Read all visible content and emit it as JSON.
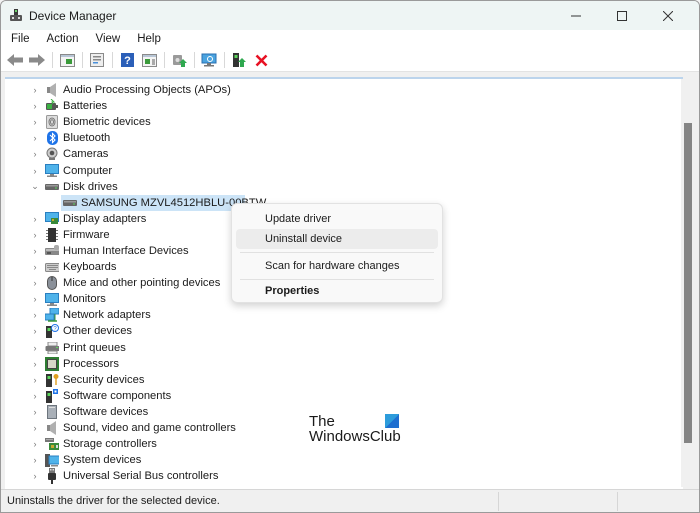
{
  "window": {
    "title": "Device Manager",
    "controls": {
      "minimize": "minimize",
      "maximize": "maximize",
      "close": "close"
    }
  },
  "menubar": {
    "items": [
      {
        "label": "File"
      },
      {
        "label": "Action"
      },
      {
        "label": "View"
      },
      {
        "label": "Help"
      }
    ]
  },
  "toolbar": {
    "buttons": [
      {
        "icon": "back-arrow-icon",
        "tooltip": "Back"
      },
      {
        "icon": "forward-arrow-icon",
        "tooltip": "Forward"
      },
      {
        "icon": "show-hide-console-tree-icon",
        "tooltip": "Show/Hide Console Tree"
      },
      {
        "icon": "properties-icon",
        "tooltip": "Properties"
      },
      {
        "icon": "help-icon",
        "tooltip": "Help"
      },
      {
        "icon": "show-action-pane-icon",
        "tooltip": "Show Action Pane"
      },
      {
        "icon": "update-driver-icon",
        "tooltip": "Update Driver"
      },
      {
        "icon": "scan-hardware-icon",
        "tooltip": "Scan for hardware changes"
      },
      {
        "icon": "enable-device-icon",
        "tooltip": "Enable device"
      },
      {
        "icon": "uninstall-device-icon",
        "tooltip": "Uninstall device"
      }
    ]
  },
  "tree": {
    "items": [
      {
        "label": "Audio Processing Objects (APOs)",
        "icon": "speaker-icon",
        "expanded": false
      },
      {
        "label": "Batteries",
        "icon": "battery-icon",
        "expanded": false
      },
      {
        "label": "Biometric devices",
        "icon": "fingerprint-icon",
        "expanded": false
      },
      {
        "label": "Bluetooth",
        "icon": "bluetooth-icon",
        "expanded": false
      },
      {
        "label": "Cameras",
        "icon": "camera-icon",
        "expanded": false
      },
      {
        "label": "Computer",
        "icon": "computer-icon",
        "expanded": false
      },
      {
        "label": "Disk drives",
        "icon": "disk-drive-icon",
        "expanded": true,
        "children": [
          {
            "label": "SAMSUNG MZVL4512HBLU-00BTW",
            "icon": "disk-drive-icon",
            "selected": true
          }
        ]
      },
      {
        "label": "Display adapters",
        "icon": "display-adapter-icon",
        "expanded": false
      },
      {
        "label": "Firmware",
        "icon": "firmware-icon",
        "expanded": false
      },
      {
        "label": "Human Interface Devices",
        "icon": "hid-icon",
        "expanded": false
      },
      {
        "label": "Keyboards",
        "icon": "keyboard-icon",
        "expanded": false
      },
      {
        "label": "Mice and other pointing devices",
        "icon": "mouse-icon",
        "expanded": false
      },
      {
        "label": "Monitors",
        "icon": "monitor-icon",
        "expanded": false
      },
      {
        "label": "Network adapters",
        "icon": "network-icon",
        "expanded": false
      },
      {
        "label": "Other devices",
        "icon": "unknown-device-icon",
        "expanded": false
      },
      {
        "label": "Print queues",
        "icon": "printer-icon",
        "expanded": false
      },
      {
        "label": "Processors",
        "icon": "processor-icon",
        "expanded": false
      },
      {
        "label": "Security devices",
        "icon": "security-key-icon",
        "expanded": false
      },
      {
        "label": "Software components",
        "icon": "software-component-icon",
        "expanded": false
      },
      {
        "label": "Software devices",
        "icon": "software-device-icon",
        "expanded": false
      },
      {
        "label": "Sound, video and game controllers",
        "icon": "speaker-icon",
        "expanded": false
      },
      {
        "label": "Storage controllers",
        "icon": "storage-controller-icon",
        "expanded": false
      },
      {
        "label": "System devices",
        "icon": "system-device-icon",
        "expanded": false
      },
      {
        "label": "Universal Serial Bus controllers",
        "icon": "usb-icon",
        "expanded": false
      }
    ]
  },
  "context_menu": {
    "items": [
      {
        "label": "Update driver"
      },
      {
        "label": "Uninstall device",
        "hovered": true
      },
      {
        "label": "Scan for hardware changes"
      },
      {
        "label": "Properties",
        "bold": true
      }
    ]
  },
  "watermark": {
    "line1": "The",
    "line2": "WindowsClub"
  },
  "statusbar": {
    "text": "Uninstalls the driver for the selected device."
  },
  "colors": {
    "selection": "#cce4f7",
    "titlebar": "#eef5f4",
    "uninstall_red": "#e81123",
    "scroll_thumb": "#858585"
  }
}
